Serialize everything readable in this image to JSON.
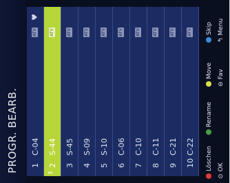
{
  "screen": {
    "title": "PROGR. BEARB."
  },
  "channels": [
    {
      "num": "1",
      "name": "C-04",
      "badge": "ATV",
      "heart": "♥"
    },
    {
      "num": "2",
      "name": "S-44",
      "badge": "ATV",
      "selected": true
    },
    {
      "num": "3",
      "name": "S-45",
      "badge": "ATV"
    },
    {
      "num": "4",
      "name": "S-09",
      "badge": "ATV"
    },
    {
      "num": "5",
      "name": "S-10",
      "badge": "ATV"
    },
    {
      "num": "6",
      "name": "C-06",
      "badge": "ATV"
    },
    {
      "num": "7",
      "name": "C-10",
      "badge": "ATV"
    },
    {
      "num": "8",
      "name": "C-11",
      "badge": "ATV"
    },
    {
      "num": "9",
      "name": "C-21",
      "badge": "ATV"
    },
    {
      "num": "10",
      "name": "C-22",
      "badge": "ATV"
    }
  ],
  "legend": {
    "delete": "Löschen",
    "rename": "Rename",
    "move": "Move",
    "skip": "Skip",
    "ok": "OK",
    "fav": "Fav",
    "menu": "Menu"
  },
  "colors": {
    "red": "#e53935",
    "green": "#43a047",
    "yellow": "#d9e04a",
    "blue": "#3d8bd8"
  }
}
